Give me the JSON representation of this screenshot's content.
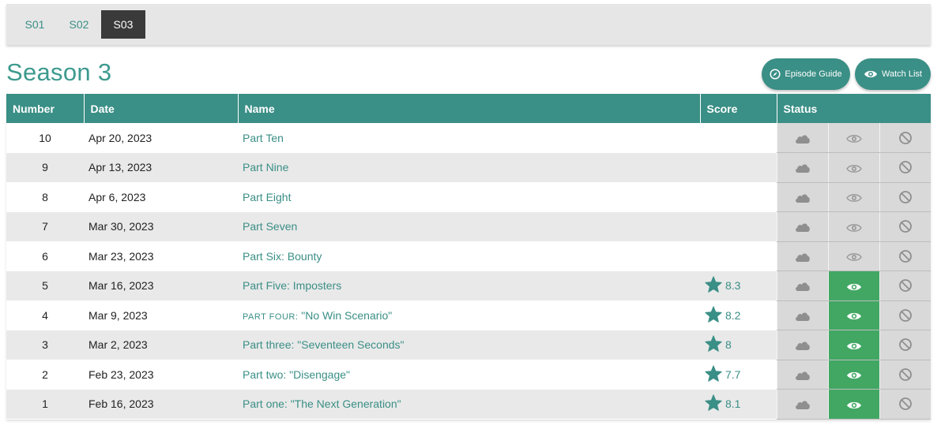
{
  "tabs": [
    {
      "label": "S01",
      "active": false
    },
    {
      "label": "S02",
      "active": false
    },
    {
      "label": "S03",
      "active": true
    }
  ],
  "page_title": "Season 3",
  "buttons": {
    "episode_guide": "Episode Guide",
    "watch_list": "Watch List"
  },
  "columns": [
    "Number",
    "Date",
    "Name",
    "Score",
    "Status"
  ],
  "episodes": [
    {
      "number": "10",
      "date": "Apr 20, 2023",
      "name": "Part Ten",
      "score": "",
      "watched": false
    },
    {
      "number": "9",
      "date": "Apr 13, 2023",
      "name": "Part Nine",
      "score": "",
      "watched": false
    },
    {
      "number": "8",
      "date": "Apr 6, 2023",
      "name": "Part Eight",
      "score": "",
      "watched": false
    },
    {
      "number": "7",
      "date": "Mar 30, 2023",
      "name": "Part Seven",
      "score": "",
      "watched": false
    },
    {
      "number": "6",
      "date": "Mar 23, 2023",
      "name": "Part Six: Bounty",
      "score": "",
      "watched": false
    },
    {
      "number": "5",
      "date": "Mar 16, 2023",
      "name": "Part Five: Imposters",
      "score": "8.3",
      "watched": true
    },
    {
      "number": "4",
      "date": "Mar 9, 2023",
      "name_prefix": "PART FOUR:",
      "name": " \"No Win Scenario\"",
      "score": "8.2",
      "watched": true
    },
    {
      "number": "3",
      "date": "Mar 2, 2023",
      "name": "Part three: \"Seventeen Seconds\"",
      "score": "8",
      "watched": true
    },
    {
      "number": "2",
      "date": "Feb 23, 2023",
      "name": "Part two: \"Disengage\"",
      "score": "7.7",
      "watched": true
    },
    {
      "number": "1",
      "date": "Feb 16, 2023",
      "name": "Part one: \"The Next Generation\"",
      "score": "8.1",
      "watched": true
    }
  ],
  "colors": {
    "accent": "#3a8f86",
    "watched_green": "#41a763",
    "status_gray": "#d9d9d9",
    "active_tab": "#3a3a3a"
  },
  "icons": {
    "score": "star-icon",
    "status": [
      "cloud-icon",
      "eye-icon",
      "ban-icon"
    ],
    "episode_guide": "compass-icon",
    "watch_list": "eye-icon"
  }
}
